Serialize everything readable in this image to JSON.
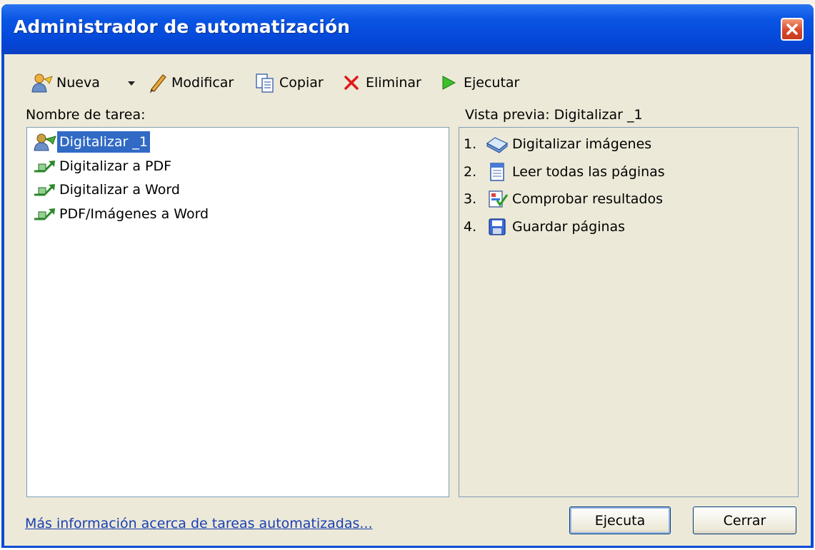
{
  "window": {
    "title": "Administrador de automatización"
  },
  "toolbar": {
    "new_label": "Nueva",
    "edit_label": "Modificar",
    "copy_label": "Copiar",
    "delete_label": "Eliminar",
    "run_label": "Ejecutar"
  },
  "tasks": {
    "header": "Nombre de tarea:",
    "items": [
      {
        "label": "Digitalizar _1",
        "icon": "custom-task-icon",
        "selected": true
      },
      {
        "label": "Digitalizar a PDF",
        "icon": "task-arrow-icon"
      },
      {
        "label": "Digitalizar a Word",
        "icon": "task-arrow-icon"
      },
      {
        "label": "PDF/Imágenes a Word",
        "icon": "task-arrow-icon"
      }
    ]
  },
  "preview": {
    "header": "Vista previa: Digitalizar _1",
    "steps": [
      {
        "num": "1.",
        "label": "Digitalizar imágenes",
        "icon": "scanner-icon"
      },
      {
        "num": "2.",
        "label": "Leer todas las páginas",
        "icon": "page-icon"
      },
      {
        "num": "3.",
        "label": "Comprobar resultados",
        "icon": "check-results-icon"
      },
      {
        "num": "4.",
        "label": "Guardar páginas",
        "icon": "save-icon"
      }
    ]
  },
  "footer": {
    "link": "Más información acerca de tareas automatizadas...",
    "run_button": "Ejecuta",
    "close_button": "Cerrar"
  },
  "colors": {
    "titlebar": "#0a55e4",
    "selection": "#316ac5",
    "dialog_bg": "#ece9d8",
    "link": "#1a3fb2"
  }
}
